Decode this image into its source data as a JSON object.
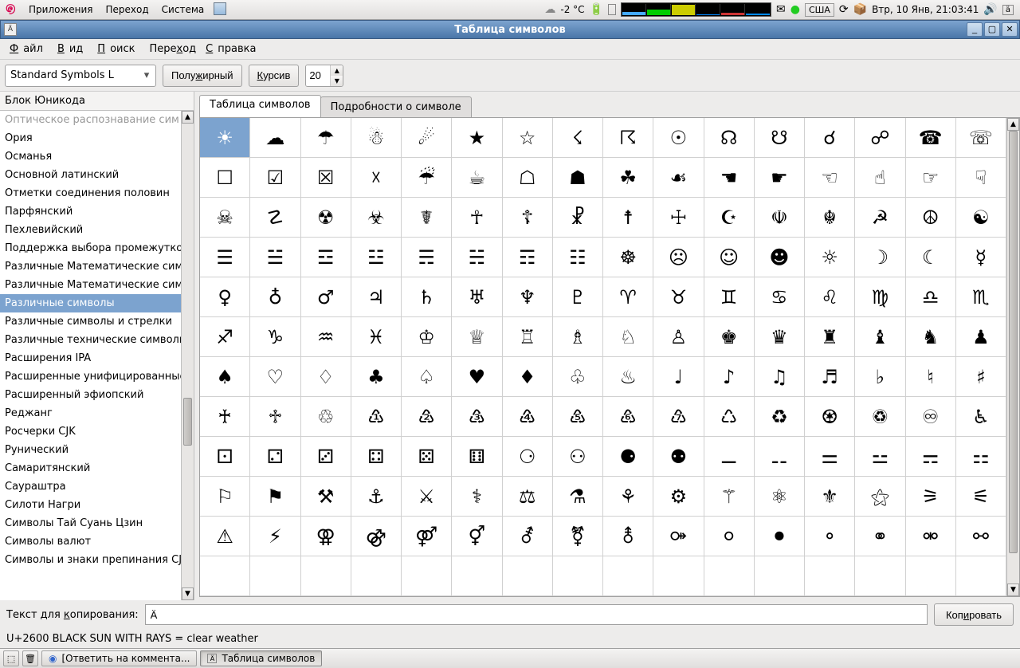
{
  "top_panel": {
    "apps": "Приложения",
    "places": "Переход",
    "system": "Система",
    "weather_temp": "-2 °C",
    "keyboard": "США",
    "clock": "Втр, 10 Янв, 21:03:41"
  },
  "window": {
    "title": "Таблица символов",
    "menu_icon": "Ä"
  },
  "menubar": {
    "file": "Файл",
    "view": "Вид",
    "search": "Поиск",
    "go": "Переход",
    "help": "Справка"
  },
  "toolbar": {
    "font": "Standard Symbols L",
    "bold": "Полужирный",
    "italic": "Курсив",
    "size": "20"
  },
  "sidebar": {
    "header": "Блок Юникода",
    "items": [
      "Оптическое распознавание сим",
      "Ория",
      "Османья",
      "Основной латинский",
      "Отметки соединения половин",
      "Парфянский",
      "Пехлевийский",
      "Поддержка выбора промежутко",
      "Различные Математические сим",
      "Различные Математические сим",
      "Различные символы",
      "Различные символы и стрелки",
      "Различные технические символь",
      "Расширения IPA",
      "Расширенные унифицированные",
      "Расширенный эфиопский",
      "Реджанг",
      "Росчерки CJK",
      "Рунический",
      "Самаритянский",
      "Саураштра",
      "Силоти Нагри",
      "Символы Тай Суань Цзин",
      "Символы валют",
      "Символы и знаки препинания CJK"
    ],
    "selected_index": 10
  },
  "tabs": {
    "chars": "Таблица символов",
    "details": "Подробности о символе"
  },
  "grid": {
    "rows": [
      [
        "☀",
        "☁",
        "☂",
        "☃",
        "☄",
        "★",
        "☆",
        "☇",
        "☈",
        "☉",
        "☊",
        "☋",
        "☌",
        "☍",
        "☎",
        "☏"
      ],
      [
        "☐",
        "☑",
        "☒",
        "☓",
        "☔",
        "☕",
        "☖",
        "☗",
        "☘",
        "☙",
        "☚",
        "☛",
        "☜",
        "☝",
        "☞",
        "☟"
      ],
      [
        "☠",
        "☡",
        "☢",
        "☣",
        "☤",
        "☥",
        "☦",
        "☧",
        "☨",
        "☩",
        "☪",
        "☫",
        "☬",
        "☭",
        "☮",
        "☯"
      ],
      [
        "☰",
        "☱",
        "☲",
        "☳",
        "☴",
        "☵",
        "☶",
        "☷",
        "☸",
        "☹",
        "☺",
        "☻",
        "☼",
        "☽",
        "☾",
        "☿"
      ],
      [
        "♀",
        "♁",
        "♂",
        "♃",
        "♄",
        "♅",
        "♆",
        "♇",
        "♈",
        "♉",
        "♊",
        "♋",
        "♌",
        "♍",
        "♎",
        "♏"
      ],
      [
        "♐",
        "♑",
        "♒",
        "♓",
        "♔",
        "♕",
        "♖",
        "♗",
        "♘",
        "♙",
        "♚",
        "♛",
        "♜",
        "♝",
        "♞",
        "♟"
      ],
      [
        "♠",
        "♡",
        "♢",
        "♣",
        "♤",
        "♥",
        "♦",
        "♧",
        "♨",
        "♩",
        "♪",
        "♫",
        "♬",
        "♭",
        "♮",
        "♯"
      ],
      [
        "♰",
        "♱",
        "♲",
        "♳",
        "♴",
        "♵",
        "♶",
        "♷",
        "♸",
        "♹",
        "♺",
        "♻",
        "♼",
        "♽",
        "♾",
        "♿"
      ],
      [
        "⚀",
        "⚁",
        "⚂",
        "⚃",
        "⚄",
        "⚅",
        "⚆",
        "⚇",
        "⚈",
        "⚉",
        "⚊",
        "⚋",
        "⚌",
        "⚍",
        "⚎",
        "⚏"
      ],
      [
        "⚐",
        "⚑",
        "⚒",
        "⚓",
        "⚔",
        "⚕",
        "⚖",
        "⚗",
        "⚘",
        "⚙",
        "⚚",
        "⚛",
        "⚜",
        "⚝",
        "⚞",
        "⚟"
      ],
      [
        "⚠",
        "⚡",
        "⚢",
        "⚣",
        "⚤",
        "⚥",
        "⚦",
        "⚧",
        "⚨",
        "⚩",
        "⚪",
        "⚫",
        "⚬",
        "⚭",
        "⚮",
        "⚯"
      ],
      [
        "",
        "",
        "",
        "",
        "",
        "",
        "",
        "",
        "",
        "",
        "",
        "",
        "",
        "",
        "",
        ""
      ]
    ]
  },
  "copy": {
    "label": "Текст для копирования:",
    "value": "Ä",
    "button": "Копировать"
  },
  "status": {
    "text": "U+2600 BLACK SUN WITH RAYS   = clear weather"
  },
  "taskbar": {
    "task1": "[Ответить на коммента...",
    "task2": "Таблица символов"
  }
}
